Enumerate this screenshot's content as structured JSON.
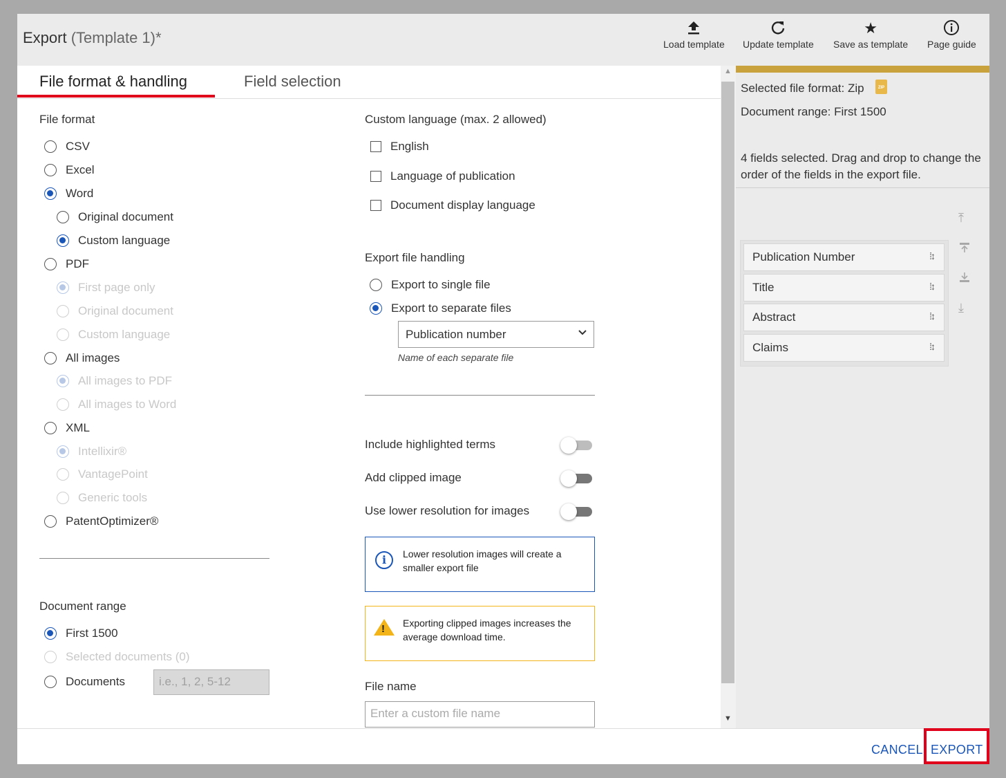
{
  "header": {
    "title": "Export",
    "subtitle": "(Template 1)*",
    "tools": [
      {
        "label": "Load template",
        "icon": "upload-icon"
      },
      {
        "label": "Update template",
        "icon": "refresh-icon"
      },
      {
        "label": "Save as template",
        "icon": "star-icon"
      },
      {
        "label": "Page guide",
        "icon": "info-icon"
      }
    ]
  },
  "tabs": [
    {
      "label": "File format & handling",
      "active": true
    },
    {
      "label": "Field selection",
      "active": false
    }
  ],
  "file_format": {
    "heading": "File format",
    "options": [
      {
        "label": "CSV",
        "checked": false,
        "disabled": false
      },
      {
        "label": "Excel",
        "checked": false,
        "disabled": false
      },
      {
        "label": "Word",
        "checked": true,
        "disabled": false
      },
      {
        "label": "Original document",
        "checked": false,
        "disabled": false
      },
      {
        "label": "Custom language",
        "checked": true,
        "disabled": false
      },
      {
        "label": "PDF",
        "checked": false,
        "disabled": false
      },
      {
        "label": "First page only",
        "checked": true,
        "disabled": true
      },
      {
        "label": "Original document",
        "checked": false,
        "disabled": true
      },
      {
        "label": "Custom language",
        "checked": false,
        "disabled": true
      },
      {
        "label": "All images",
        "checked": false,
        "disabled": false
      },
      {
        "label": "All images to PDF",
        "checked": true,
        "disabled": true
      },
      {
        "label": "All images to Word",
        "checked": false,
        "disabled": true
      },
      {
        "label": "XML",
        "checked": false,
        "disabled": false
      },
      {
        "label": "Intellixir®",
        "checked": true,
        "disabled": true
      },
      {
        "label": "VantagePoint",
        "checked": false,
        "disabled": true
      },
      {
        "label": "Generic tools",
        "checked": false,
        "disabled": true
      },
      {
        "label": "PatentOptimizer®",
        "checked": false,
        "disabled": false
      }
    ]
  },
  "document_range": {
    "heading": "Document range",
    "options": [
      {
        "label": "First 1500",
        "checked": true,
        "disabled": false
      },
      {
        "label": "Selected documents (0)",
        "checked": false,
        "disabled": true
      },
      {
        "label": "Documents",
        "checked": false,
        "disabled": false
      }
    ],
    "documents_placeholder": "i.e., 1, 2, 5-12"
  },
  "custom_language": {
    "heading": "Custom language (max. 2 allowed)",
    "options": [
      {
        "label": "English",
        "checked": false
      },
      {
        "label": "Language of publication",
        "checked": false
      },
      {
        "label": "Document display language",
        "checked": false
      }
    ]
  },
  "export_handling": {
    "heading": "Export file handling",
    "options": [
      {
        "label": "Export to single file",
        "checked": false
      },
      {
        "label": "Export to separate files",
        "checked": true
      }
    ],
    "select_value": "Publication number",
    "select_hint": "Name of each separate file"
  },
  "toggles": [
    {
      "label": "Include highlighted terms",
      "on": false
    },
    {
      "label": "Add clipped image",
      "on": false
    },
    {
      "label": "Use lower resolution for images",
      "on": false
    }
  ],
  "info_message": "Lower resolution images will create a smaller export file",
  "warning_message": "Exporting clipped images increases the average download time.",
  "file_name": {
    "label": "File name",
    "placeholder": "Enter a custom file name"
  },
  "right_panel": {
    "format_label": "Selected file format:",
    "format_value": "Zip",
    "zip_icon_text": "ZIP",
    "range_label": "Document range:",
    "range_value": "First 1500",
    "fields_info": "4 fields selected. Drag and drop to change the order of the fields in the export file.",
    "fields": [
      "Publication Number",
      "Title",
      "Abstract",
      "Claims"
    ]
  },
  "footer": {
    "cancel": "CANCEL",
    "export": "EXPORT"
  },
  "colors": {
    "accent": "#1a56b8",
    "active_tab": "#e0001b",
    "highlight": "#e0001b",
    "warning": "#f2b418",
    "panel_top": "#c9a23e"
  }
}
